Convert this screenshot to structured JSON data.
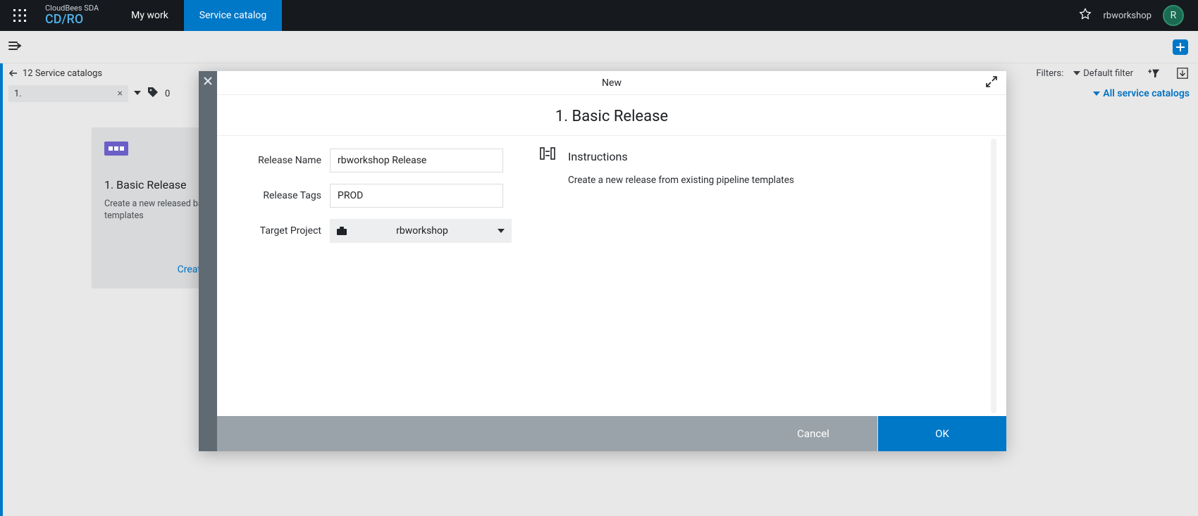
{
  "header": {
    "brand_top": "CloudBees SDA",
    "brand_bottom": "CD/RO",
    "nav": {
      "my_work": "My work",
      "service_catalog": "Service catalog"
    },
    "user": "rbworkshop",
    "avatar_initial": "R"
  },
  "crumb": {
    "back": "12 Service catalogs",
    "filters_label": "Filters:",
    "default_filter": "Default filter"
  },
  "filterrow": {
    "search_value": "1.",
    "tag_count": "0",
    "all_catalogs": "All service catalogs"
  },
  "card": {
    "title": "1. Basic Release",
    "desc": "Create a new released based on pipeline templates",
    "create": "Create"
  },
  "modal": {
    "hdr": "New",
    "title": "1. Basic Release",
    "form": {
      "release_name_label": "Release Name",
      "release_name_value": "rbworkshop Release",
      "release_tags_label": "Release Tags",
      "release_tags_value": "PROD",
      "target_project_label": "Target Project",
      "target_project_value": "rbworkshop"
    },
    "instructions_title": "Instructions",
    "instructions_text": "Create a new release from existing pipeline templates",
    "cancel": "Cancel",
    "ok": "OK"
  }
}
